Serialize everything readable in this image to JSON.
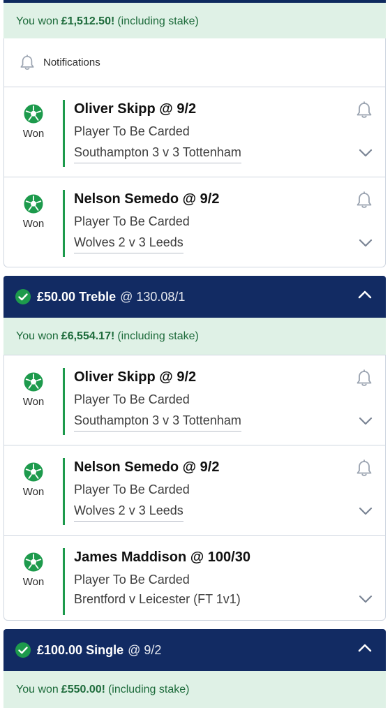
{
  "colors": {
    "won_green": "#1d9a4c",
    "header_navy": "#122b63",
    "banner_bg": "#dff1e6",
    "won_text": "#1d6b3b"
  },
  "banner1": {
    "pre": "You won",
    "amount": "£1,512.50!",
    "post": "(including stake)"
  },
  "notifications": {
    "icon": "bell-icon",
    "label": "Notifications"
  },
  "group1": {
    "legs": [
      {
        "status": "Won",
        "selection": "Oliver Skipp @ 9/2",
        "market": "Player To Be Carded",
        "event": "Southampton 3 v 3 Tottenham"
      },
      {
        "status": "Won",
        "selection": "Nelson Semedo @ 9/2",
        "market": "Player To Be Carded",
        "event": "Wolves 2 v 3 Leeds"
      }
    ]
  },
  "treble": {
    "stake": "£50.00",
    "type": "Treble",
    "odds": "@ 130.08/1"
  },
  "banner2": {
    "pre": "You won",
    "amount": "£6,554.17!",
    "post": "(including stake)"
  },
  "group2": {
    "legs": [
      {
        "status": "Won",
        "selection": "Oliver Skipp @ 9/2",
        "market": "Player To Be Carded",
        "event": "Southampton 3 v 3 Tottenham"
      },
      {
        "status": "Won",
        "selection": "Nelson Semedo @ 9/2",
        "market": "Player To Be Carded",
        "event": "Wolves 2 v 3 Leeds"
      },
      {
        "status": "Won",
        "selection": "James Maddison @ 100/30",
        "market": "Player To Be Carded",
        "event": "Brentford v Leicester (FT 1v1)"
      }
    ]
  },
  "single": {
    "stake": "£100.00",
    "type": "Single",
    "odds": "@ 9/2"
  },
  "banner3": {
    "pre": "You won",
    "amount": "£550.00!",
    "post": "(including stake)"
  }
}
